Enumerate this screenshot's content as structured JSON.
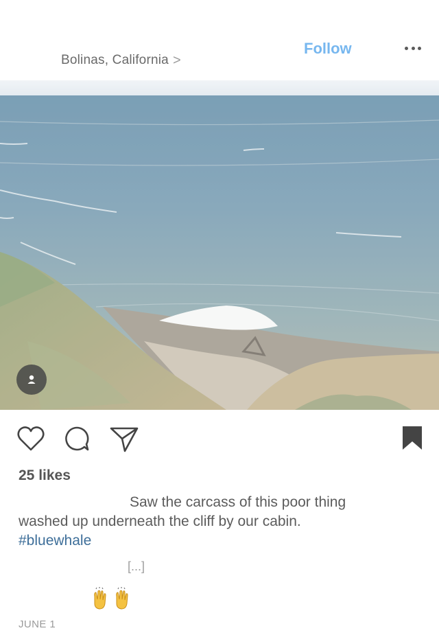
{
  "header": {
    "location": "Bolinas, California",
    "location_chevron": ">",
    "follow_label": "Follow",
    "more_icon": "ellipsis-icon"
  },
  "post": {
    "photo_alt": "beach-cliff-ocean-photo",
    "likes": "25 likes",
    "caption_line1": "Saw the carcass of this poor thing",
    "caption_line2": "washed up underneath the cliff by our cabin.",
    "hashtag": "#bluewhale",
    "more_label": "[...]",
    "emoji": "🙌🙌",
    "date": "JUNE 1"
  },
  "icons": {
    "like": "heart-icon",
    "comment": "comment-icon",
    "share": "paper-plane-icon",
    "save": "bookmark-icon",
    "tag": "person-tag-icon"
  },
  "colors": {
    "follow": "#77b7ef",
    "hashtag": "#3d6e99",
    "text": "#5b5b5b"
  }
}
